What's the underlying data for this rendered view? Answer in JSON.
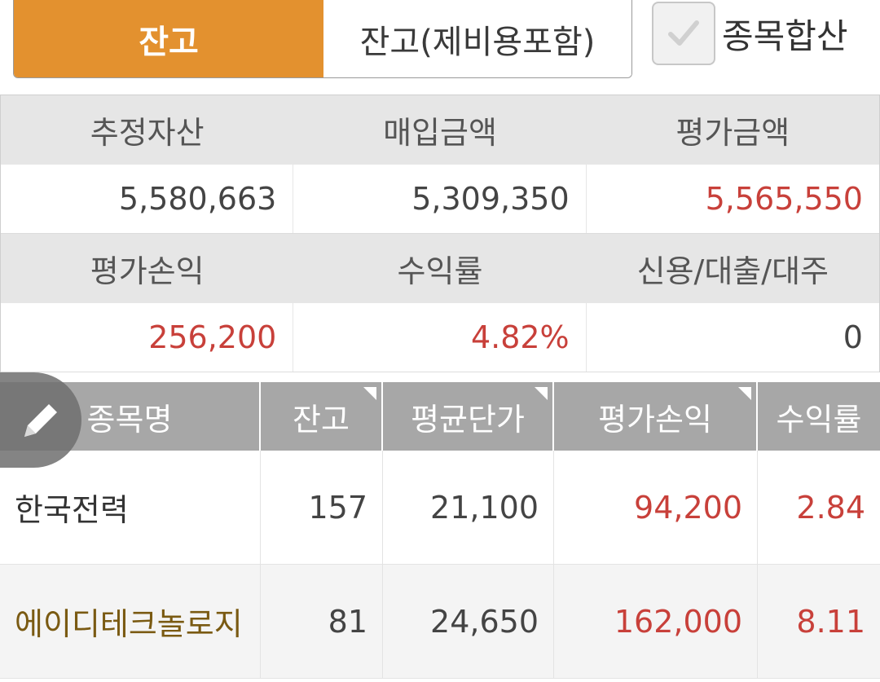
{
  "tabs": [
    {
      "label": "잔고",
      "active": true
    },
    {
      "label": "잔고(제비용포함)",
      "active": false
    }
  ],
  "merge_checkbox": {
    "label": "종목합산",
    "checked": true
  },
  "summary": {
    "headers1": [
      "추정자산",
      "매입금액",
      "평가금액"
    ],
    "values1": [
      "5,580,663",
      "5,309,350",
      "5,565,550"
    ],
    "headers2": [
      "평가손익",
      "수익률",
      "신용/대출/대주"
    ],
    "values2": [
      "256,200",
      "4.82%",
      "0"
    ]
  },
  "holdings": {
    "columns": [
      "종목명",
      "잔고",
      "평균단가",
      "평가손익",
      "수익률"
    ],
    "rows": [
      {
        "name": "한국전력",
        "qty": "157",
        "avg_price": "21,100",
        "pnl": "94,200",
        "rate": "2.84"
      },
      {
        "name": "에이디테크놀로지",
        "qty": "81",
        "avg_price": "24,650",
        "pnl": "162,000",
        "rate": "8.11"
      }
    ]
  },
  "colors": {
    "accent": "#e3912f",
    "positive": "#c8403a",
    "header_gray": "#a7a7a7"
  },
  "icons": {
    "edit": "pencil-icon",
    "check": "check-icon"
  }
}
